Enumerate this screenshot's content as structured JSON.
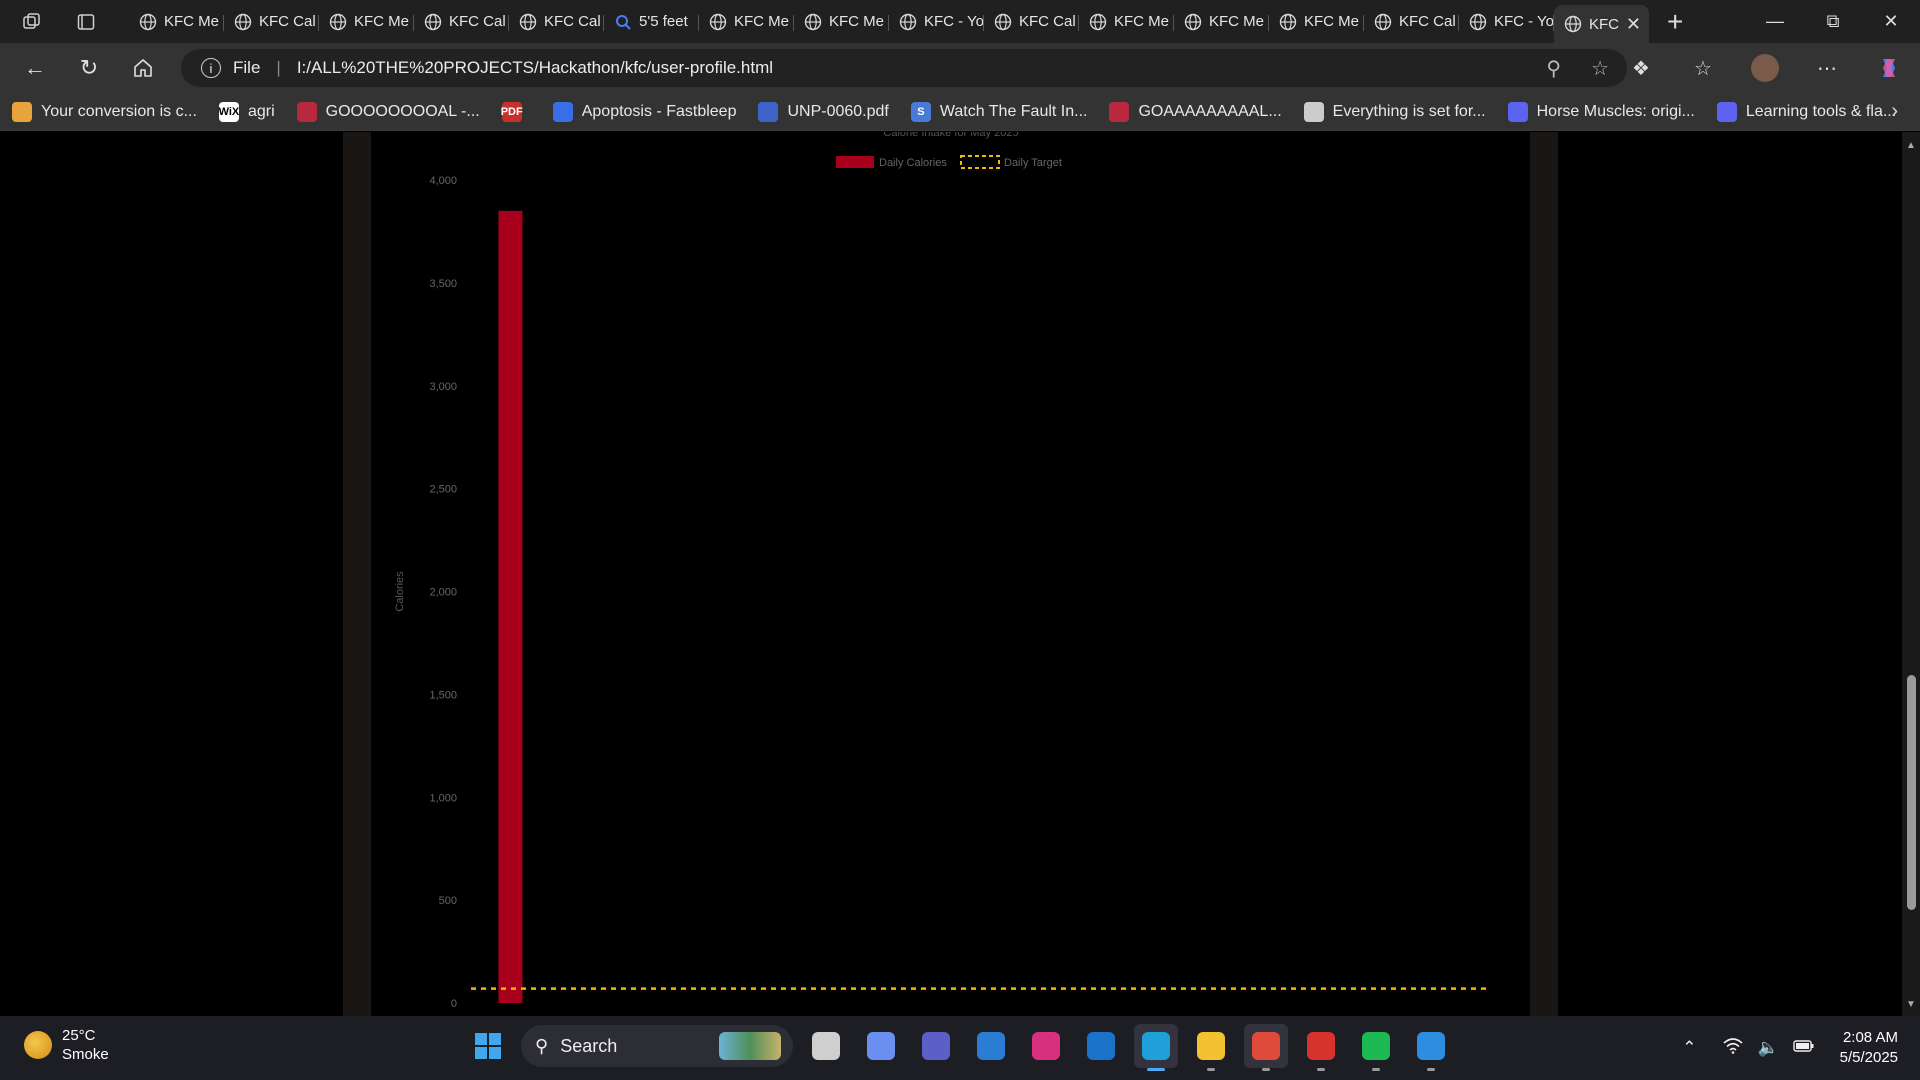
{
  "browser": {
    "tabs": [
      {
        "label": "KFC Me",
        "icon": "globe-icon"
      },
      {
        "label": "KFC Cal",
        "icon": "globe-icon"
      },
      {
        "label": "KFC Me",
        "icon": "globe-icon"
      },
      {
        "label": "KFC Cal",
        "icon": "globe-icon"
      },
      {
        "label": "KFC Cal",
        "icon": "globe-icon"
      },
      {
        "label": "5'5 feet",
        "icon": "search-icon"
      },
      {
        "label": "KFC Me",
        "icon": "globe-icon"
      },
      {
        "label": "KFC Me",
        "icon": "globe-icon"
      },
      {
        "label": "KFC - Yo",
        "icon": "globe-icon"
      },
      {
        "label": "KFC Cal",
        "icon": "globe-icon"
      },
      {
        "label": "KFC Me",
        "icon": "globe-icon"
      },
      {
        "label": "KFC Me",
        "icon": "globe-icon"
      },
      {
        "label": "KFC Me",
        "icon": "globe-icon"
      },
      {
        "label": "KFC Cal",
        "icon": "globe-icon"
      },
      {
        "label": "KFC - Yo",
        "icon": "globe-icon"
      },
      {
        "label": "KFC",
        "icon": "globe-icon",
        "active": true
      }
    ],
    "address": {
      "scheme_label": "File",
      "url": "I:/ALL%20THE%20PROJECTS/Hackathon/kfc/user-profile.html"
    },
    "bookmarks": [
      {
        "label": "Your conversion is c...",
        "color": "#e8a33a"
      },
      {
        "label": "agri",
        "color": "#ffffff",
        "icon_text": "WiX"
      },
      {
        "label": "GOOOOOOOOAL -...",
        "color": "#b8283e"
      },
      {
        "label": "",
        "color": "#c8302e",
        "icon_text": "PDF"
      },
      {
        "label": "Apoptosis - Fastbleep",
        "color": "#3a6ee8"
      },
      {
        "label": "UNP-0060.pdf",
        "color": "#3b66c8"
      },
      {
        "label": "Watch The Fault In...",
        "color": "#4a7ad8",
        "icon_text": "S"
      },
      {
        "label": "GOAAAAAAAAAL...",
        "color": "#b8283e"
      },
      {
        "label": "Everything is set for...",
        "color": "#cccccc"
      },
      {
        "label": "Horse Muscles: origi...",
        "color": "#5b63f0"
      },
      {
        "label": "Learning tools & fla...",
        "color": "#5b63f0"
      }
    ]
  },
  "chart_data": {
    "type": "bar",
    "title_partial": "Calorie Intake for May 2025",
    "legend": [
      {
        "name": "Daily Calories",
        "color": "#a8001c",
        "style": "solid"
      },
      {
        "name": "Daily Target",
        "color": "#f5b800",
        "style": "dashed"
      }
    ],
    "ylabel": "Calories",
    "ylim": [
      0,
      4000
    ],
    "yticks": [
      0,
      500,
      1000,
      1500,
      2000,
      2500,
      3000,
      3500,
      4000
    ],
    "ytick_labels": [
      "0",
      "500",
      "1,000",
      "1,500",
      "2,000",
      "2,500",
      "3,000",
      "3,500",
      "4,000"
    ],
    "num_categories": 31,
    "bars": [
      {
        "index": 0,
        "value": 3850
      }
    ],
    "target_value": 70,
    "bar_color": "#a8001c",
    "target_color": "#f5b800",
    "grid": false
  },
  "taskbar": {
    "weather": {
      "temp": "25°C",
      "condition": "Smoke"
    },
    "search_placeholder": "Search",
    "apps": [
      {
        "name": "task-view-icon",
        "color": "#cfcfcf"
      },
      {
        "name": "copilot-icon",
        "color": "#6b8ff0"
      },
      {
        "name": "teams-icon",
        "color": "#5b5fc7"
      },
      {
        "name": "store-icon",
        "color": "#2b7cd3"
      },
      {
        "name": "instagram-icon",
        "color": "#d6307e"
      },
      {
        "name": "outlook-icon",
        "color": "#1a73c8"
      },
      {
        "name": "edge-icon",
        "color": "#1fa0d8"
      },
      {
        "name": "file-explorer-icon",
        "color": "#f2c230"
      },
      {
        "name": "chrome-icon",
        "color": "#e04a3a"
      },
      {
        "name": "wps-office-icon",
        "color": "#d7322c"
      },
      {
        "name": "spotify-icon",
        "color": "#1db954"
      },
      {
        "name": "vscode-icon",
        "color": "#2d8de0"
      }
    ],
    "clock": {
      "time": "2:08 AM",
      "date": "5/5/2025"
    }
  }
}
